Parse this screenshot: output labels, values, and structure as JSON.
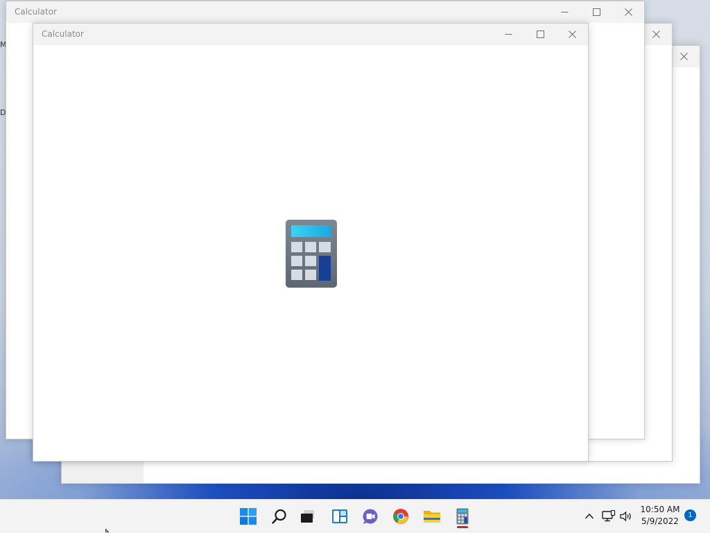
{
  "desktop": {
    "edge_glyphs": [
      "M",
      "D"
    ]
  },
  "windows": [
    {
      "title": "Calculator",
      "state": "background"
    },
    {
      "title": "",
      "state": "background"
    },
    {
      "title": "",
      "state": "background"
    },
    {
      "title": "Calculator",
      "state": "foreground-splash"
    }
  ],
  "caption_buttons": {
    "minimize": "minimize-icon",
    "maximize": "maximize-icon",
    "close": "close-icon"
  },
  "splash": {
    "icon": "calculator-app-icon"
  },
  "taskbar": {
    "icons": [
      {
        "name": "start-button",
        "icon": "windows-logo-icon"
      },
      {
        "name": "search-button",
        "icon": "search-icon"
      },
      {
        "name": "task-view-button",
        "icon": "task-view-icon"
      },
      {
        "name": "widgets-button",
        "icon": "widgets-icon"
      },
      {
        "name": "chat-button",
        "icon": "teams-chat-icon"
      },
      {
        "name": "chrome-button",
        "icon": "chrome-icon"
      },
      {
        "name": "file-explorer-button",
        "icon": "folder-icon"
      },
      {
        "name": "calculator-taskbar-button",
        "icon": "calculator-icon",
        "active": true
      }
    ],
    "tray": {
      "overflow_icon": "chevron-up-icon",
      "network_icon": "network-icon",
      "volume_icon": "volume-icon",
      "time": "10:50 AM",
      "date": "5/9/2022",
      "notification_count": "1"
    }
  },
  "colors": {
    "taskbar_bg": "#f3f3f3",
    "titlebar_bg": "#f3f3f3",
    "accent_blue": "#0067c0",
    "active_indicator": "#c42b1c",
    "calc_screen": "#29c3f0",
    "calc_body": "#6f7a86",
    "calc_equals": "#1a46a0"
  }
}
